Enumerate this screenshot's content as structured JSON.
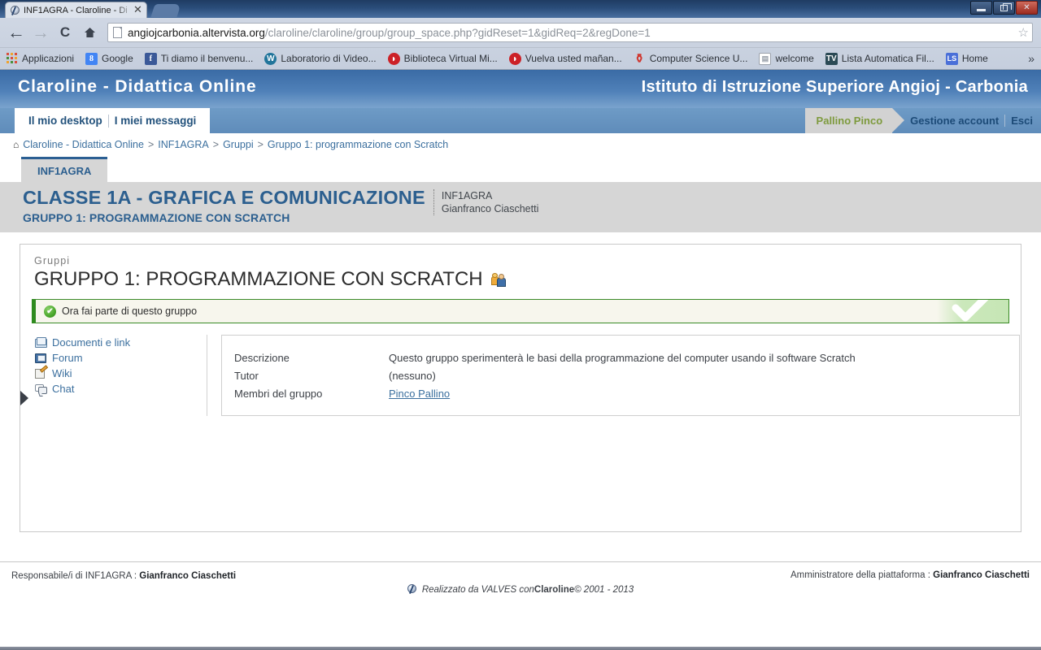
{
  "browser": {
    "tab": {
      "title": "INF1AGRA - Claroline - Di",
      "close_label": "✕"
    },
    "nav": {
      "back": "←",
      "forward": "→",
      "reload": "C",
      "home": "⌂"
    },
    "omnibox": {
      "url_strong": "angiojcarbonia.altervista.org",
      "url_rest": "/claroline/claroline/group/group_space.php?gidReset=1&gidReq=2&regDone=1",
      "star": "☆"
    },
    "window": {
      "minimize": "—",
      "maximize": "❐",
      "close": "✕"
    },
    "bookmarks": [
      {
        "label": "Applicazioni",
        "icon": "apps-grid-icon",
        "kind": "apps"
      },
      {
        "label": "Google",
        "icon": "google-icon",
        "kind": "google",
        "glyph": "8"
      },
      {
        "label": "Ti diamo il benvenu...",
        "icon": "facebook-icon",
        "kind": "fb",
        "glyph": "f"
      },
      {
        "label": "Laboratorio di Video...",
        "icon": "wordpress-icon",
        "kind": "wp",
        "glyph": "W"
      },
      {
        "label": "Biblioteca Virtual Mi...",
        "icon": "red-circle-icon",
        "kind": "red",
        "glyph": "✦"
      },
      {
        "label": "Vuelva usted mañan...",
        "icon": "red-circle-icon",
        "kind": "red",
        "glyph": "✦"
      },
      {
        "label": "Computer Science U...",
        "icon": "red-pin-icon",
        "kind": "pin",
        "glyph": "⚲"
      },
      {
        "label": "welcome",
        "icon": "document-icon",
        "kind": "doc",
        "glyph": ""
      },
      {
        "label": "Lista Automatica Fil...",
        "icon": "dark-tv-icon",
        "kind": "dark",
        "glyph": "TV"
      },
      {
        "label": "Home",
        "icon": "ls-icon",
        "kind": "ls",
        "glyph": "LS"
      }
    ],
    "bookmarks_overflow": "»"
  },
  "site": {
    "logo": "Claroline - Didattica Online",
    "institution": "Istituto di Istruzione Superiore Angioj - Carbonia",
    "nav_left": [
      {
        "label": "Il mio desktop"
      },
      {
        "label": "I miei messaggi"
      }
    ],
    "nav_right": {
      "user": "Pallino Pinco",
      "account": "Gestione account",
      "logout": "Esci"
    },
    "breadcrumb": {
      "home_icon": "home-icon",
      "items": [
        "Claroline - Didattica Online",
        "INF1AGRA",
        "Gruppi",
        "Gruppo 1: programmazione con Scratch"
      ],
      "separator": ">"
    }
  },
  "course": {
    "tab_label": "INF1AGRA",
    "title": "CLASSE 1A - GRAFICA E COMUNICAZIONE",
    "subtitle": "GRUPPO 1: PROGRAMMAZIONE CON SCRATCH",
    "code": "INF1AGRA",
    "teacher": "Gianfranco Ciaschetti"
  },
  "content": {
    "kicker": "Gruppi",
    "group_title": "GRUPPO 1: PROGRAMMAZIONE CON SCRATCH",
    "group_icon": "group-users-icon",
    "alert": {
      "icon": "check-circle-icon",
      "text": "Ora fai parte di questo gruppo",
      "accent_color": "#2f8b1f",
      "bg_color": "#f7f6ed"
    },
    "tools": [
      {
        "label": "Documenti e link",
        "icon": "folder-icon"
      },
      {
        "label": "Forum",
        "icon": "forum-icon"
      },
      {
        "label": "Wiki",
        "icon": "wiki-pencil-icon"
      },
      {
        "label": "Chat",
        "icon": "chat-bubbles-icon"
      }
    ],
    "info": [
      {
        "label": "Descrizione",
        "value": "Questo gruppo sperimenterà le basi della programmazione del computer usando il software Scratch",
        "is_link": false
      },
      {
        "label": "Tutor",
        "value": "(nessuno)",
        "is_link": false
      },
      {
        "label": "Membri del gruppo",
        "value": "Pinco Pallino",
        "is_link": true
      }
    ]
  },
  "footer": {
    "left_prefix": "Responsabile/i di INF1AGRA : ",
    "left_name": "Gianfranco Ciaschetti",
    "right_prefix": "Amministratore della piattaforma : ",
    "right_name": "Gianfranco Ciaschetti",
    "center_prefix": "Realizzato da VALVES con ",
    "center_brand": "Claroline",
    "center_suffix": " © 2001 - 2013",
    "logo_icon": "claroline-logo-icon"
  }
}
